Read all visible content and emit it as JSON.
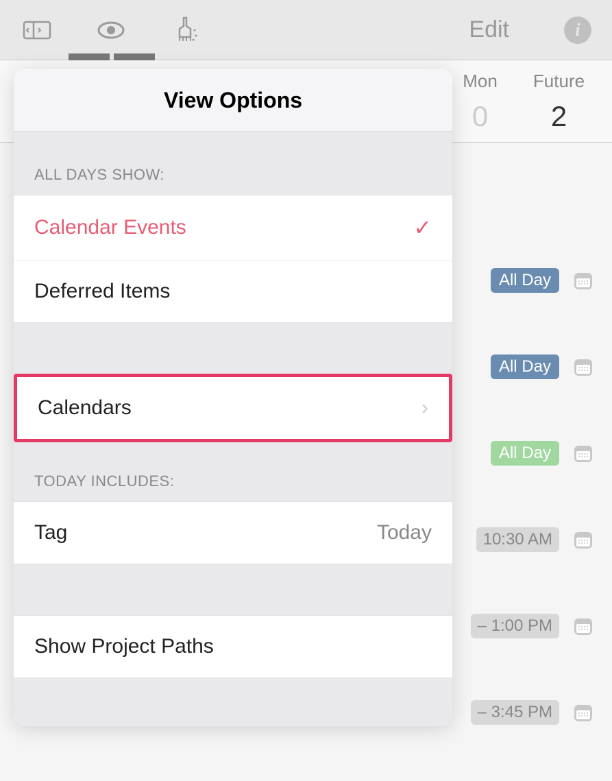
{
  "toolbar": {
    "edit_label": "Edit"
  },
  "day_header": {
    "mon": {
      "label": "Mon",
      "count": "0"
    },
    "future": {
      "label": "Future",
      "count": "2"
    }
  },
  "bg_items": {
    "row1": {
      "badge": "All Day"
    },
    "row2": {
      "badge": "All Day"
    },
    "row3": {
      "badge": "All Day"
    },
    "row4": {
      "time": "10:30 AM"
    },
    "row5": {
      "time": "– 1:00 PM"
    },
    "row6": {
      "time": "– 3:45 PM"
    }
  },
  "popover": {
    "title": "View Options",
    "section_all_days": "ALL DAYS SHOW:",
    "calendar_events": "Calendar Events",
    "deferred_items": "Deferred Items",
    "calendars": "Calendars",
    "section_today": "TODAY INCLUDES:",
    "tag_label": "Tag",
    "tag_value": "Today",
    "show_paths": "Show Project Paths"
  }
}
